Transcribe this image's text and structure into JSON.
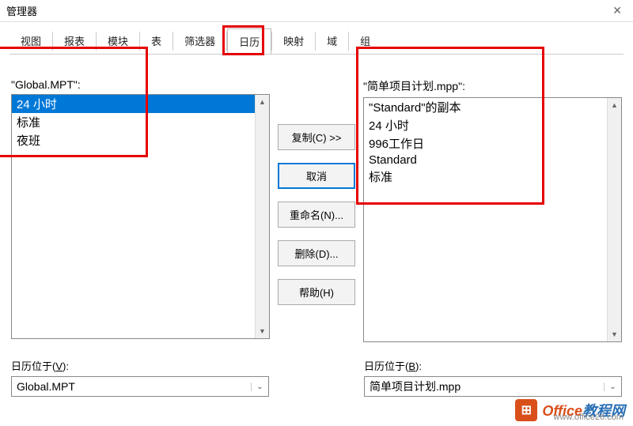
{
  "title": "管理器",
  "tabs": [
    "视图",
    "报表",
    "模块",
    "表",
    "筛选器",
    "日历",
    "映射",
    "域",
    "组"
  ],
  "active_tab_index": 5,
  "left": {
    "label": "\"Global.MPT\":",
    "items": [
      "24 小时",
      "标准",
      "夜班"
    ],
    "selected_index": 0
  },
  "right": {
    "label": "\"简单项目计划.mpp\":",
    "items": [
      "\"Standard\"的副本",
      "24 小时",
      "996工作日",
      "Standard",
      "标准"
    ]
  },
  "buttons": {
    "copy": "复制(C) >>",
    "cancel": "取消",
    "rename": "重命名(N)...",
    "delete": "删除(D)...",
    "help": "帮助(H)"
  },
  "bottom": {
    "left_label_pre": "日历位于(",
    "left_label_key": "V",
    "left_label_post": "):",
    "left_value": "Global.MPT",
    "right_label_pre": "日历位于(",
    "right_label_key": "B",
    "right_label_post": "):",
    "right_value": "简单项目计划.mpp"
  },
  "watermark": {
    "brand1": "Office",
    "brand2": "教程网",
    "url": "www.office26.com"
  }
}
